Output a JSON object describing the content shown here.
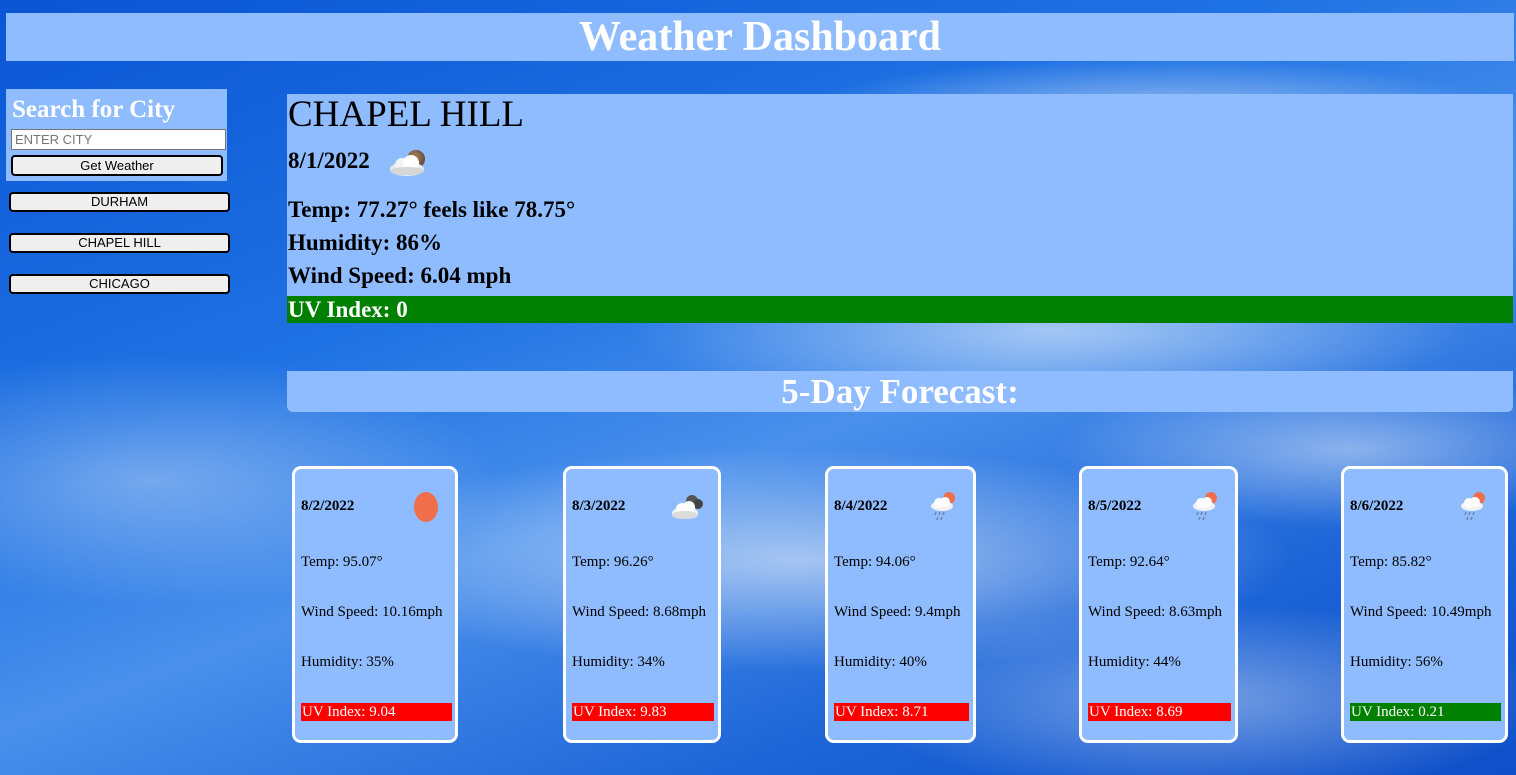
{
  "header": {
    "title": "Weather Dashboard"
  },
  "search": {
    "title": "Search for City",
    "placeholder": "ENTER CITY",
    "value": "",
    "button_label": "Get Weather"
  },
  "history": [
    {
      "label": "DURHAM"
    },
    {
      "label": "CHAPEL HILL"
    },
    {
      "label": "CHICAGO"
    }
  ],
  "current": {
    "city": "CHAPEL HILL",
    "date": "8/1/2022",
    "icon": "partly-cloudy-icon",
    "temp": "Temp: 77.27° feels like 78.75°",
    "humidity": "Humidity: 86%",
    "wind": "Wind Speed: 6.04 mph",
    "uv": "UV Index: 0",
    "uv_color": "#008000"
  },
  "forecast": {
    "title": "5-Day Forecast:",
    "days": [
      {
        "date": "8/2/2022",
        "icon": "sun-icon",
        "temp": "Temp: 95.07°",
        "wind": "Wind Speed: 10.16mph",
        "humidity": "Humidity: 35%",
        "uv": "UV Index: 9.04",
        "uv_color": "#ff0000"
      },
      {
        "date": "8/3/2022",
        "icon": "clouds-icon",
        "temp": "Temp: 96.26°",
        "wind": "Wind Speed: 8.68mph",
        "humidity": "Humidity: 34%",
        "uv": "UV Index: 9.83",
        "uv_color": "#ff0000"
      },
      {
        "date": "8/4/2022",
        "icon": "rain-icon",
        "temp": "Temp: 94.06°",
        "wind": "Wind Speed: 9.4mph",
        "humidity": "Humidity: 40%",
        "uv": "UV Index: 8.71",
        "uv_color": "#ff0000"
      },
      {
        "date": "8/5/2022",
        "icon": "rain-icon",
        "temp": "Temp: 92.64°",
        "wind": "Wind Speed: 8.63mph",
        "humidity": "Humidity: 44%",
        "uv": "UV Index: 8.69",
        "uv_color": "#ff0000"
      },
      {
        "date": "8/6/2022",
        "icon": "rain-icon",
        "temp": "Temp: 85.82°",
        "wind": "Wind Speed: 10.49mph",
        "humidity": "Humidity: 56%",
        "uv": "UV Index: 0.21",
        "uv_color": "#008000"
      }
    ]
  },
  "colors": {
    "panel": "#8fbcff",
    "uv_high": "#ff0000",
    "uv_low": "#008000",
    "sun": "#ef6f4a"
  }
}
